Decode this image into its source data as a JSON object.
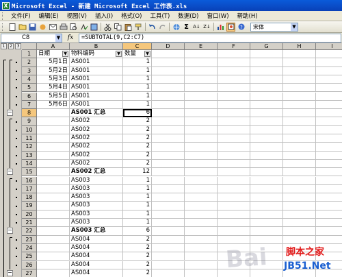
{
  "window": {
    "title": "Microsoft Excel - 新建 Microsoft Excel 工作表.xls",
    "app_icon": "X"
  },
  "menu": [
    "文件(F)",
    "编辑(E)",
    "视图(V)",
    "插入(I)",
    "格式(O)",
    "工具(T)",
    "数据(D)",
    "窗口(W)",
    "帮助(H)"
  ],
  "toolbar": {
    "font_name": "宋体"
  },
  "formula_bar": {
    "name_box": "C8",
    "fx": "fx",
    "formula": "=SUBTOTAL(9,C2:C7)"
  },
  "outline_levels": [
    "1",
    "2",
    "3"
  ],
  "columns": [
    "A",
    "B",
    "C",
    "D",
    "E",
    "F",
    "G",
    "H",
    "I"
  ],
  "rows": [
    {
      "n": "1",
      "a": "日期",
      "b": "物料编码",
      "c": "数量",
      "header": true
    },
    {
      "n": "2",
      "a": "5月1日",
      "b": "AS001",
      "c": "1"
    },
    {
      "n": "3",
      "a": "5月2日",
      "b": "AS001",
      "c": "1"
    },
    {
      "n": "4",
      "a": "5月3日",
      "b": "AS001",
      "c": "1"
    },
    {
      "n": "5",
      "a": "5月4日",
      "b": "AS001",
      "c": "1"
    },
    {
      "n": "6",
      "a": "5月5日",
      "b": "AS001",
      "c": "1"
    },
    {
      "n": "7",
      "a": "5月6日",
      "b": "AS001",
      "c": "1"
    },
    {
      "n": "8",
      "a": "",
      "b": "AS001 汇总",
      "c": "6",
      "summary": true
    },
    {
      "n": "9",
      "a": "",
      "b": "AS002",
      "c": "2"
    },
    {
      "n": "10",
      "a": "",
      "b": "AS002",
      "c": "2"
    },
    {
      "n": "11",
      "a": "",
      "b": "AS002",
      "c": "2"
    },
    {
      "n": "12",
      "a": "",
      "b": "AS002",
      "c": "2"
    },
    {
      "n": "13",
      "a": "",
      "b": "AS002",
      "c": "2"
    },
    {
      "n": "14",
      "a": "",
      "b": "AS002",
      "c": "2"
    },
    {
      "n": "15",
      "a": "",
      "b": "AS002 汇总",
      "c": "12",
      "summary": true
    },
    {
      "n": "16",
      "a": "",
      "b": "AS003",
      "c": "1"
    },
    {
      "n": "17",
      "a": "",
      "b": "AS003",
      "c": "1"
    },
    {
      "n": "18",
      "a": "",
      "b": "AS003",
      "c": "1"
    },
    {
      "n": "19",
      "a": "",
      "b": "AS003",
      "c": "1"
    },
    {
      "n": "20",
      "a": "",
      "b": "AS003",
      "c": "1"
    },
    {
      "n": "21",
      "a": "",
      "b": "AS003",
      "c": "1"
    },
    {
      "n": "22",
      "a": "",
      "b": "AS003 汇总",
      "c": "6",
      "summary": true
    },
    {
      "n": "23",
      "a": "",
      "b": "AS004",
      "c": "2"
    },
    {
      "n": "24",
      "a": "",
      "b": "AS004",
      "c": "2"
    },
    {
      "n": "25",
      "a": "",
      "b": "AS004",
      "c": "2"
    },
    {
      "n": "26",
      "a": "",
      "b": "AS004",
      "c": "2"
    },
    {
      "n": "27",
      "a": "",
      "b": "AS004",
      "c": "2"
    }
  ],
  "selected_cell": "C8",
  "watermarks": {
    "baidu": "Bai",
    "jiaoben": "脚本之家",
    "jb51": "JB51.Net"
  }
}
